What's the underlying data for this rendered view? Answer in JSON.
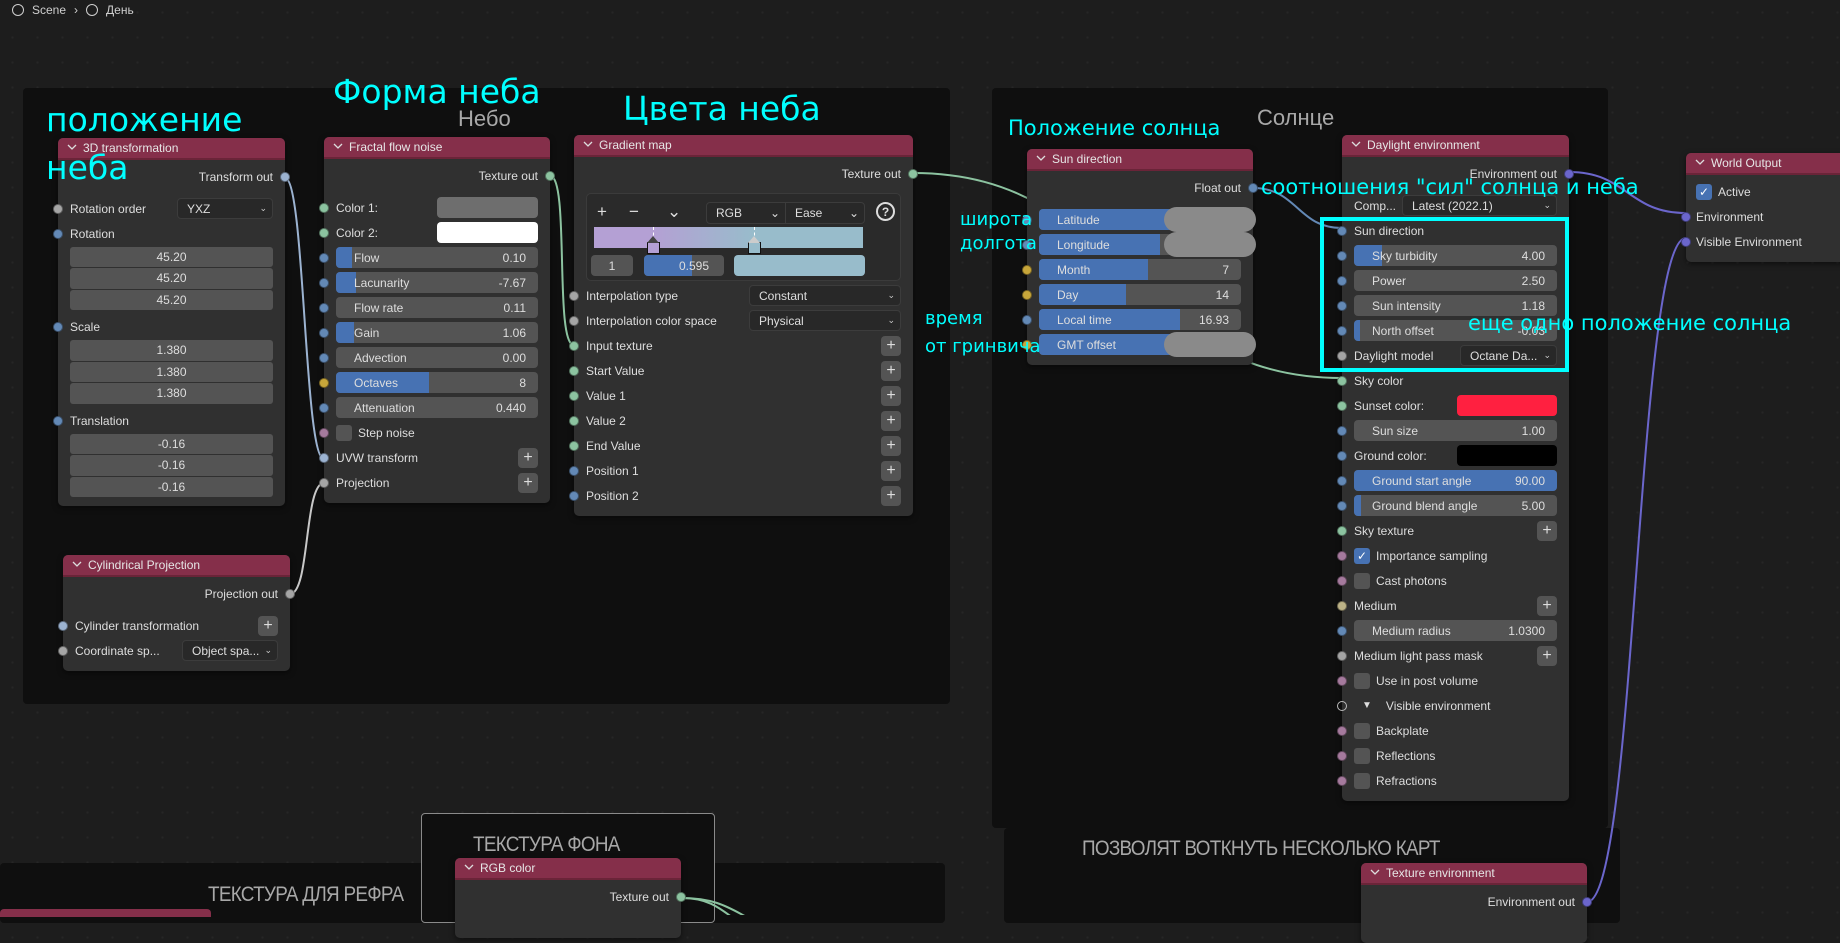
{
  "breadcrumb": {
    "items": [
      "Scene",
      "День"
    ]
  },
  "frames": {
    "sky": "Небо",
    "sun": "Солнце",
    "bg_texture": "ТЕКСТУРА ФОНА",
    "reflection_texture": "ТЕКСТУРА ДЛЯ РЕФРА",
    "multi_maps": "ПОЗВОЛЯТ ВОТКНУТЬ НЕСКОЛЬКО КАРТ"
  },
  "annotations": {
    "sky_position_1": "положение",
    "sky_position_2": "неба",
    "sky_shape": "Форма неба",
    "sky_colors": "Цвета неба",
    "sun_position": "Положение солнца",
    "ratio": "соотношения \"сил\" солнца и неба",
    "latitude": "широта",
    "longitude": "долгота",
    "time_1": "время",
    "time_2": "от гринвича",
    "sun_position_2": "еще одно положение солнца"
  },
  "colors": {
    "node_header": "#852f4a",
    "annotation": "#00ffff",
    "slider_fill": "#4772b3",
    "wire_texture": "#8cc3a0",
    "wire_environment": "#6b66cc"
  },
  "socket_colors": {
    "g": "#a5a5a5",
    "f": "#6389b6",
    "t": "#8cc3a0",
    "i": "#c7a63a",
    "b": "#a57a9d",
    "e": "#6b66cc",
    "m": "#bdb387",
    "x": "#9cb3d1",
    "h": "none"
  },
  "nodes": {
    "transform3d": {
      "title": "3D transformation",
      "rows": [
        {
          "kind": "out",
          "label": "Transform out",
          "socket": "x"
        },
        {
          "kind": "dd",
          "label": "Rotation order",
          "value": "YXZ",
          "socket": "g"
        },
        {
          "kind": "lbl",
          "label": "Rotation",
          "socket": "f"
        },
        {
          "kind": "fld",
          "value": "45.20"
        },
        {
          "kind": "fld",
          "value": "45.20"
        },
        {
          "kind": "fld",
          "value": "45.20"
        },
        {
          "kind": "lbl",
          "label": "Scale",
          "socket": "f"
        },
        {
          "kind": "fld",
          "value": "1.380"
        },
        {
          "kind": "fld",
          "value": "1.380"
        },
        {
          "kind": "fld",
          "value": "1.380"
        },
        {
          "kind": "lbl",
          "label": "Translation",
          "socket": "f"
        },
        {
          "kind": "fld",
          "value": "-0.16"
        },
        {
          "kind": "fld",
          "value": "-0.16"
        },
        {
          "kind": "fld",
          "value": "-0.16"
        }
      ]
    },
    "fractal": {
      "title": "Fractal flow noise",
      "rows": [
        {
          "kind": "out",
          "label": "Texture out",
          "socket": "t"
        },
        {
          "kind": "color",
          "label": "Color 1:",
          "color": "#6e6e6e",
          "socket": "t"
        },
        {
          "kind": "color",
          "label": "Color 2:",
          "color": "#ffffff",
          "socket": "t"
        },
        {
          "kind": "slider",
          "label": "Flow",
          "value": "0.10",
          "fill": 0.08,
          "socket": "f"
        },
        {
          "kind": "slider",
          "label": "Lacunarity",
          "value": "-7.67",
          "fill": 0.1,
          "socket": "f"
        },
        {
          "kind": "slider",
          "label": "Flow rate",
          "value": "0.11",
          "fill": 0,
          "socket": "f"
        },
        {
          "kind": "slider",
          "label": "Gain",
          "value": "1.06",
          "fill": 0.09,
          "socket": "f"
        },
        {
          "kind": "slider",
          "label": "Advection",
          "value": "0.00",
          "fill": 0,
          "socket": "f"
        },
        {
          "kind": "slider",
          "label": "Octaves",
          "value": "8",
          "fill": 0.46,
          "socket": "i"
        },
        {
          "kind": "slider",
          "label": "Attenuation",
          "value": "0.440",
          "fill": 0,
          "socket": "f"
        },
        {
          "kind": "check",
          "label": "Step noise",
          "checked": false,
          "socket": "b"
        },
        {
          "kind": "plus",
          "label": "UVW transform",
          "socket": "x"
        },
        {
          "kind": "plus",
          "label": "Projection",
          "socket": "g"
        }
      ]
    },
    "gradient": {
      "title": "Gradient map",
      "rows": [
        {
          "kind": "out",
          "label": "Texture out",
          "socket": "t"
        },
        {
          "kind": "gradient",
          "add": "+",
          "remove": "−",
          "menu": "⌄",
          "mode": "RGB",
          "interpolation": "Ease",
          "help": "?",
          "stops": [
            {
              "pos": 0.22,
              "color": "#b4a0d4"
            },
            {
              "pos": 0.595,
              "color": "#98bccb"
            }
          ],
          "selected_index": "1",
          "selected_position": "0.595",
          "selected_color": "#98bccb"
        },
        {
          "kind": "dd",
          "label": "Interpolation type",
          "value": "Constant",
          "socket": "g"
        },
        {
          "kind": "dd",
          "label": "Interpolation color space",
          "value": "Physical",
          "socket": "g"
        },
        {
          "kind": "plus",
          "label": "Input texture",
          "socket": "t"
        },
        {
          "kind": "plus",
          "label": "Start Value",
          "socket": "t"
        },
        {
          "kind": "plus",
          "label": "Value 1",
          "socket": "t"
        },
        {
          "kind": "plus",
          "label": "Value 2",
          "socket": "t"
        },
        {
          "kind": "plus",
          "label": "End Value",
          "socket": "t"
        },
        {
          "kind": "plus",
          "label": "Position 1",
          "socket": "f"
        },
        {
          "kind": "plus",
          "label": "Position 2",
          "socket": "f"
        }
      ]
    },
    "cylindrical": {
      "title": "Cylindrical Projection",
      "rows": [
        {
          "kind": "out",
          "label": "Projection out",
          "socket": "g"
        },
        {
          "kind": "plus",
          "label": "Cylinder transformation",
          "socket": "x"
        },
        {
          "kind": "dd",
          "label": "Coordinate sp...",
          "value": "Object spa...",
          "socket": "g"
        }
      ]
    },
    "sun": {
      "title": "Sun direction",
      "rows": [
        {
          "kind": "out",
          "label": "Float out",
          "socket": "f"
        },
        {
          "kind": "slider",
          "label": "Latitude",
          "fill": 0.65,
          "redacted": true,
          "socket": "f"
        },
        {
          "kind": "slider",
          "label": "Longitude",
          "fill": 0.6,
          "redacted": true,
          "socket": "f"
        },
        {
          "kind": "slider",
          "label": "Month",
          "value": "7",
          "fill": 0.54,
          "socket": "i"
        },
        {
          "kind": "slider",
          "label": "Day",
          "value": "14",
          "fill": 0.43,
          "socket": "i"
        },
        {
          "kind": "slider",
          "label": "Local time",
          "value": "16.93",
          "fill": 0.7,
          "socket": "f"
        },
        {
          "kind": "slider",
          "label": "GMT offset",
          "fill": 0.68,
          "redacted": true,
          "socket": "i"
        }
      ]
    },
    "daylight": {
      "title": "Daylight environment",
      "rows": [
        {
          "kind": "out",
          "label": "Environment out",
          "socket": "e"
        },
        {
          "kind": "dd",
          "label": "Comp...",
          "value": "Latest (2022.1)"
        },
        {
          "kind": "lbl",
          "label": "Sun direction",
          "socket": "f"
        },
        {
          "kind": "slider",
          "label": "Sky turbidity",
          "value": "4.00",
          "fill": 0.14,
          "socket": "f"
        },
        {
          "kind": "slider",
          "label": "Power",
          "value": "2.50",
          "fill": 0,
          "socket": "f"
        },
        {
          "kind": "slider",
          "label": "Sun intensity",
          "value": "1.18",
          "fill": 0,
          "socket": "f"
        },
        {
          "kind": "slider",
          "label": "North offset",
          "value": "-0.03",
          "fill": 0.03,
          "socket": "f"
        },
        {
          "kind": "dd",
          "label": "Daylight model",
          "value": "Octane Da...",
          "socket": "g"
        },
        {
          "kind": "lbl",
          "label": "Sky color",
          "socket": "t"
        },
        {
          "kind": "color",
          "label": "Sunset color:",
          "color": "#ff2040",
          "socket": "t"
        },
        {
          "kind": "slider",
          "label": "Sun size",
          "value": "1.00",
          "fill": 0,
          "socket": "f"
        },
        {
          "kind": "color",
          "label": "Ground color:",
          "color": "#000000",
          "socket": "f"
        },
        {
          "kind": "slider",
          "label": "Ground start angle",
          "value": "90.00",
          "fill": 1,
          "socket": "f"
        },
        {
          "kind": "slider",
          "label": "Ground blend angle",
          "value": "5.00",
          "fill": 0.035,
          "socket": "f"
        },
        {
          "kind": "plus",
          "label": "Sky texture",
          "socket": "t"
        },
        {
          "kind": "check",
          "label": "Importance sampling",
          "checked": true,
          "socket": "b"
        },
        {
          "kind": "check",
          "label": "Cast photons",
          "checked": false,
          "socket": "b"
        },
        {
          "kind": "plus",
          "label": "Medium",
          "socket": "m"
        },
        {
          "kind": "slider",
          "label": "Medium radius",
          "value": "1.0300",
          "fill": 0,
          "socket": "f"
        },
        {
          "kind": "plus",
          "label": "Medium light pass mask",
          "socket": "g"
        },
        {
          "kind": "check",
          "label": "Use in post volume",
          "checked": false,
          "socket": "b"
        },
        {
          "kind": "section",
          "label": "Visible environment",
          "socket": "h"
        },
        {
          "kind": "check",
          "label": "Backplate",
          "checked": false,
          "socket": "b"
        },
        {
          "kind": "check",
          "label": "Reflections",
          "checked": false,
          "socket": "b"
        },
        {
          "kind": "check",
          "label": "Refractions",
          "checked": false,
          "socket": "b"
        }
      ]
    },
    "world": {
      "title": "World Output",
      "rows": [
        {
          "kind": "check",
          "label": "Active",
          "checked": true
        },
        {
          "kind": "lbl",
          "label": "Environment",
          "socket": "e"
        },
        {
          "kind": "lbl",
          "label": "Visible Environment",
          "socket": "e"
        }
      ]
    },
    "rgb": {
      "title": "RGB color",
      "rows": [
        {
          "kind": "out",
          "label": "Texture out",
          "socket": "t"
        }
      ]
    },
    "texenv": {
      "title": "Texture environment",
      "rows": [
        {
          "kind": "out",
          "label": "Environment out",
          "socket": "e"
        }
      ]
    }
  }
}
